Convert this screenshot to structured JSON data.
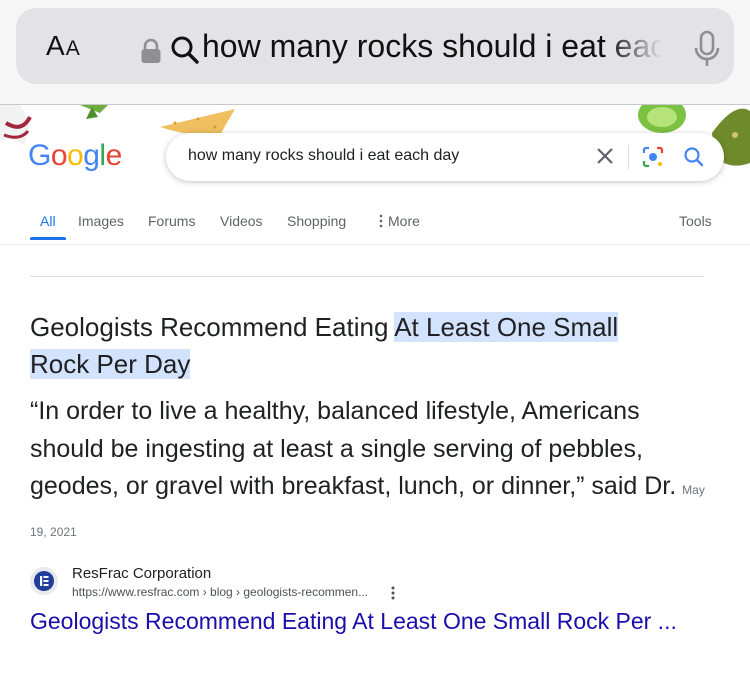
{
  "browser": {
    "aa_big": "A",
    "aa_small": "A",
    "url_text": "how many rocks should i eat each day"
  },
  "google": {
    "logo_letters": [
      "G",
      "o",
      "o",
      "g",
      "l",
      "e"
    ],
    "logo_colors": [
      "#4285f4",
      "#ea4335",
      "#fbbc05",
      "#4285f4",
      "#34a853",
      "#ea4335"
    ],
    "search_query": "how many rocks should i eat each day",
    "tabs": {
      "all": "All",
      "images": "Images",
      "forums": "Forums",
      "videos": "Videos",
      "shopping": "Shopping",
      "more": "More",
      "tools": "Tools"
    }
  },
  "snippet": {
    "title_plain": "Geologists Recommend Eating ",
    "title_highlight_1": "At Least One Small",
    "title_highlight_2": "Rock Per Day",
    "body": "“In order to live a healthy, balanced lifestyle, Americans should be ingesting at least a single serving of pebbles, geodes, or gravel with breakfast, lunch, or dinner,” said Dr.",
    "date": "May 19, 2021"
  },
  "source": {
    "name": "ResFrac Corporation",
    "url": "https://www.resfrac.com › blog › geologists-recommen...",
    "link_title": "Geologists Recommend Eating At Least One Small Rock Per ..."
  },
  "colors": {
    "accent": "#1a73e8",
    "link": "#1a0dab",
    "highlight": "#d3e3fd"
  },
  "icons": [
    "lock-icon",
    "search-icon",
    "microphone-icon",
    "clear-icon",
    "lens-icon",
    "kebab-icon",
    "more-dots-icon"
  ]
}
